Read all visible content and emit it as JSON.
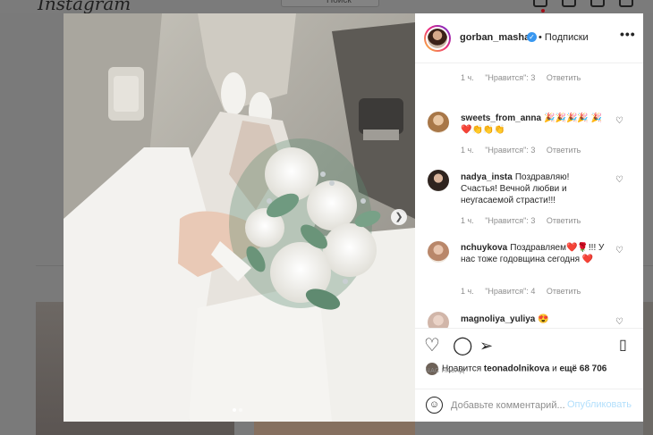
{
  "background": {
    "logo": "Instagram",
    "search_placeholder": "Поиск"
  },
  "post": {
    "author": "gorban_masha",
    "follow_label": "• Подписки",
    "more_label": "•••",
    "likes_prefix": "Нравится",
    "likes_user": "teonadolnikova",
    "likes_middle": "и",
    "likes_count": "ещё 68 706",
    "posted_time": "ЧАС НАЗАД"
  },
  "comments": [
    {
      "time": "1 ч.",
      "likes": "\"Нравится\": 3",
      "reply": "Ответить"
    },
    {
      "user": "sweets_from_anna",
      "text": "🎉🎉🎉🎉 🎉❤️👏👏👏",
      "time": "1 ч.",
      "likes": "\"Нравится\": 3",
      "reply": "Ответить"
    },
    {
      "user": "nadya_insta",
      "text": "Поздравляю! Счастья! Вечной любви и неугасаемой страсти!!!",
      "time": "1 ч.",
      "likes": "\"Нравится\": 3",
      "reply": "Ответить"
    },
    {
      "user": "nchuykova",
      "text": "Поздравляем❤️🌹!!! У нас тоже годовщина сегодня ❤️",
      "time": "1 ч.",
      "likes": "\"Нравится\": 4",
      "reply": "Ответить"
    },
    {
      "user": "magnoliya_yuliya",
      "text": "😍"
    }
  ],
  "add_comment": {
    "placeholder": "Добавьте комментарий...",
    "publish_label": "Опубликовать"
  },
  "colors": {
    "accent": "#3897f0",
    "publish_disabled": "#b2dffc",
    "muted_text": "#8e8e8e"
  }
}
